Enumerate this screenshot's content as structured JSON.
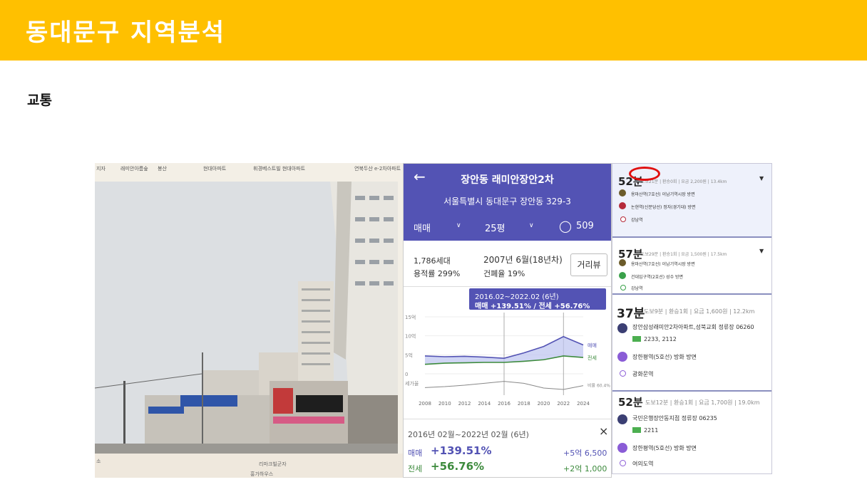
{
  "header": {
    "title": "동대문구 지역분석"
  },
  "section": {
    "title": "교통"
  },
  "map": {
    "top_labels": [
      "지자",
      "래미안아름숲",
      "봉산",
      "현대아파트",
      "휘경베스트빌 현대아파트",
      "연북두산 e-2차아파트"
    ],
    "bottom_labels": [
      "소",
      "리마크빌군자",
      "홍가하우스"
    ]
  },
  "app": {
    "title": "장안동 래미안장안2차",
    "address": "서울특별시 동대문구 장안동 329-3",
    "tab_trade": "매매",
    "tab_size": "25평",
    "comments": "509",
    "households": "1,786세대",
    "built": "2007년 6월(18년차)",
    "far": "용적률 299%",
    "bcr": "건폐율 19%",
    "street_view_button": "거리뷰",
    "tooltip_period": "2016.02~2022.02 (6년)",
    "tooltip_values": "매매 +139.51%  /  전세 +56.76%",
    "summary_period": "2016년 02월~2022년 02월 (6년)",
    "trade_label": "매매",
    "trade_change": "+139.51%",
    "trade_amount": "+5억 6,500",
    "rent_label": "전세",
    "rent_change": "+56.76%",
    "rent_amount": "+2억 1,000",
    "colors": {
      "header": "#5353b4",
      "trade": "#5353b4",
      "rent": "#3c8a3c"
    }
  },
  "chart_data": {
    "type": "line",
    "x": [
      "2008",
      "2010",
      "2012",
      "2014",
      "2016",
      "2018",
      "2020",
      "2022",
      "2024"
    ],
    "xlabel": "",
    "ylabel": "",
    "ylim": [
      0,
      15
    ],
    "y_ticks": [
      "15억",
      "10억",
      "5억",
      "0"
    ],
    "secondary_label": "세가율",
    "series": [
      {
        "name": "매매",
        "values": [
          4.7,
          4.5,
          4.6,
          4.4,
          4.1,
          5.5,
          7.2,
          9.8,
          7.6
        ]
      },
      {
        "name": "전세",
        "values": [
          2.5,
          2.8,
          2.9,
          3.0,
          3.0,
          3.3,
          3.7,
          4.7,
          4.3
        ]
      },
      {
        "name": "비율 60.4%",
        "values": [
          53,
          55,
          58,
          62,
          66,
          62,
          52,
          49,
          57
        ]
      }
    ]
  },
  "routes": [
    {
      "time": "52분",
      "meta": "도보21분 | 환승0회 | 요금 2,200원 | 13.4km",
      "steps": [
        "용마산역(7호선) 이남기역시장 방면",
        "논현역(신분당선) 정자(경기대) 방면",
        "강남역"
      ]
    },
    {
      "time": "57분",
      "meta": "도보29분 | 환승1회 | 요금 1,500원 | 17.5km",
      "steps": [
        "용마산역(7호선) 이남기역시장 방면",
        "건대입구역(2호선) 성수 방면",
        "강남역"
      ]
    },
    {
      "time": "37분",
      "meta": "도보9분 | 환승1회 | 요금 1,600원 | 12.2km",
      "steps": [
        "장안삼성래미안2차아파트,성북교회 정류장 06260",
        "2233, 2112",
        "장한평역(5호선) 방화 방면",
        "광화문역"
      ]
    },
    {
      "time": "52분",
      "meta": "도보12분 | 환승1회 | 요금 1,700원 | 19.0km",
      "steps": [
        "국민은행장안동지점 정류장 06235",
        "2211",
        "장한평역(5호선) 방화 방면",
        "여의도역"
      ]
    }
  ]
}
